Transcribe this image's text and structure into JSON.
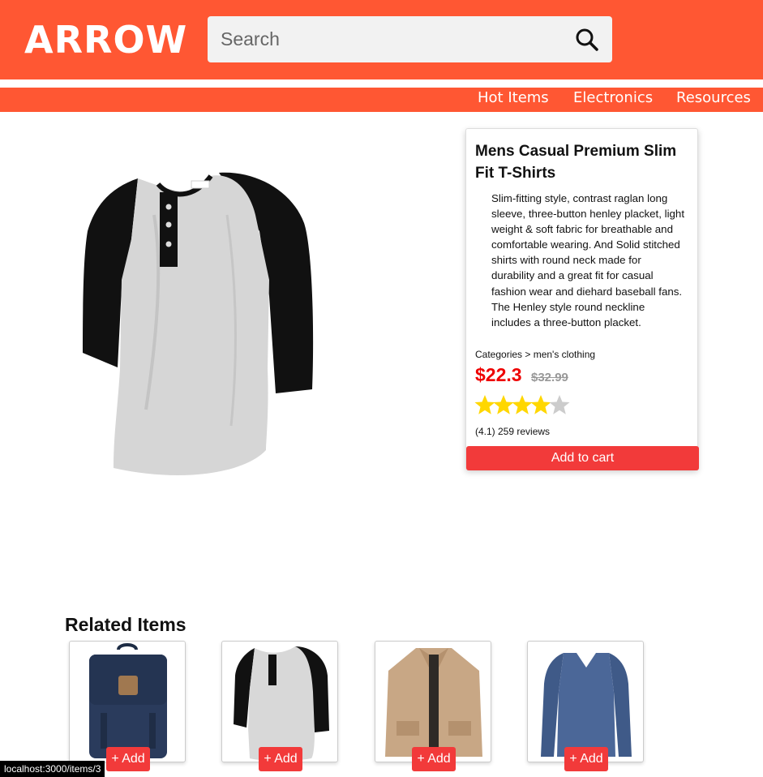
{
  "header": {
    "logo": "ARROW",
    "search_placeholder": "Search",
    "search_icon": "search-icon",
    "background_color": "#ff5733"
  },
  "nav": {
    "items": [
      {
        "label": "Hot Items"
      },
      {
        "label": "Electronics"
      },
      {
        "label": "Resources"
      }
    ]
  },
  "product": {
    "title": "Mens Casual Premium Slim Fit T-Shirts",
    "description": "Slim-fitting style, contrast raglan long sleeve, three-button henley placket, light weight & soft fabric for breathable and comfortable wearing. And Solid stitched shirts with round neck made for durability and a great fit for casual fashion wear and diehard baseball fans. The Henley style round neckline includes a three-button placket.",
    "category": "Categories > men's clothing",
    "price": "$22.3",
    "old_price": "$32.99",
    "rating_value": 4,
    "rating_max": 5,
    "reviews": "(4.1) 259 reviews",
    "add_to_cart": "Add to cart",
    "accent_color": "#f23a3a",
    "price_color": "#ee0000",
    "star_color": "#ffd700"
  },
  "related": {
    "title": "Related Items",
    "items": [
      {
        "image": "backpack",
        "add_label": "+ Add"
      },
      {
        "image": "henley-shirt",
        "add_label": "+ Add"
      },
      {
        "image": "jacket",
        "add_label": "+ Add"
      },
      {
        "image": "long-sleeve-shirt",
        "add_label": "+ Add"
      }
    ]
  },
  "status_bar": {
    "url": "localhost:3000/items/3"
  }
}
